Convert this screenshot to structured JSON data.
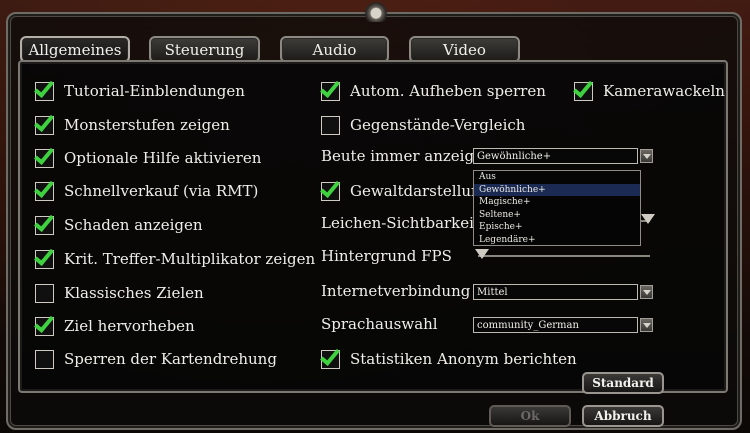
{
  "tabs": [
    {
      "label": "Allgemeines",
      "active": true
    },
    {
      "label": "Steuerung",
      "active": false
    },
    {
      "label": "Audio",
      "active": false
    },
    {
      "label": "Video",
      "active": false
    }
  ],
  "left_options": [
    {
      "label": "Tutorial-Einblendungen",
      "checked": true
    },
    {
      "label": "Monsterstufen zeigen",
      "checked": true
    },
    {
      "label": "Optionale Hilfe aktivieren",
      "checked": true
    },
    {
      "label": "Schnellverkauf (via RMT)",
      "checked": true
    },
    {
      "label": "Schaden anzeigen",
      "checked": true
    },
    {
      "label": "Krit. Treffer-Multiplikator zeigen",
      "checked": true
    },
    {
      "label": "Klassisches Zielen",
      "checked": false
    },
    {
      "label": "Ziel hervorheben",
      "checked": true
    },
    {
      "label": "Sperren der Kartendrehung",
      "checked": false
    }
  ],
  "mid": {
    "autom_aufheben": {
      "label": "Autom. Aufheben sperren",
      "checked": true
    },
    "kamerawackeln": {
      "label": "Kamerawackeln",
      "checked": true
    },
    "gegenstaende": {
      "label": "Gegenstände-Vergleich",
      "checked": false
    },
    "beute": {
      "label": "Beute immer anzeigen",
      "value": "Gewöhnliche+"
    },
    "gewalt": {
      "label": "Gewaltdarstellung",
      "checked": true
    },
    "leichen": {
      "label": "Leichen-Sichtbarkeit"
    },
    "hintergrund": {
      "label": "Hintergrund FPS",
      "level": 0
    },
    "internet": {
      "label": "Internetverbindung",
      "value": "Mittel"
    },
    "sprache": {
      "label": "Sprachauswahl",
      "value": "community_German"
    },
    "statistiken": {
      "label": "Statistiken Anonym berichten",
      "checked": true
    }
  },
  "dropdown_open": {
    "options": [
      "Aus",
      "Gewöhnliche+",
      "Magische+",
      "Seltene+",
      "Epische+",
      "Legendäre+"
    ],
    "selected": "Gewöhnliche+"
  },
  "buttons": {
    "standard": "Standard",
    "ok": "Ok",
    "abbruch": "Abbruch"
  }
}
